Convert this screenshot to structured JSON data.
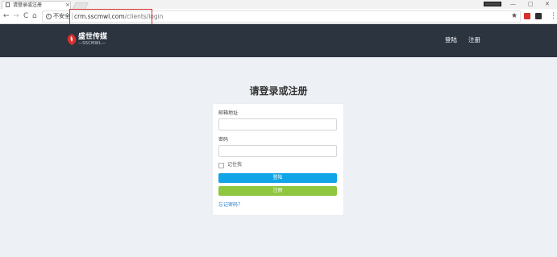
{
  "browser": {
    "tab_title": "请登录或注册",
    "tab_close": "×",
    "window_controls": [
      "—",
      "▢",
      "✕"
    ],
    "nav": {
      "back": "←",
      "forward": "→",
      "reload": "C",
      "home": "⌂"
    },
    "address": {
      "security_label": "不安全",
      "url_host": "crm.sscmwl.com",
      "url_path": "/clients/login"
    },
    "bookmark_icon": "★",
    "menu_icon": "⋮",
    "extension_colors": [
      "#d9312e",
      "#2f2f2f"
    ],
    "highlight_color": "#d9312e"
  },
  "header": {
    "logo_cn": "盛世传媒",
    "logo_en": "—SSCMWL—",
    "logo_color": "#d9312e",
    "nav": {
      "login": "登陆",
      "register": "注册"
    },
    "background": "#2c3440"
  },
  "main": {
    "title": "请登录或注册",
    "email_label": "邮箱地址",
    "password_label": "密码",
    "remember_label": "记住我",
    "login_button": "登陆",
    "register_button": "注册",
    "forgot_link": "忘记密码？",
    "colors": {
      "login": "#11a4e6",
      "register": "#8ec63f",
      "link": "#2a7bc9"
    }
  }
}
